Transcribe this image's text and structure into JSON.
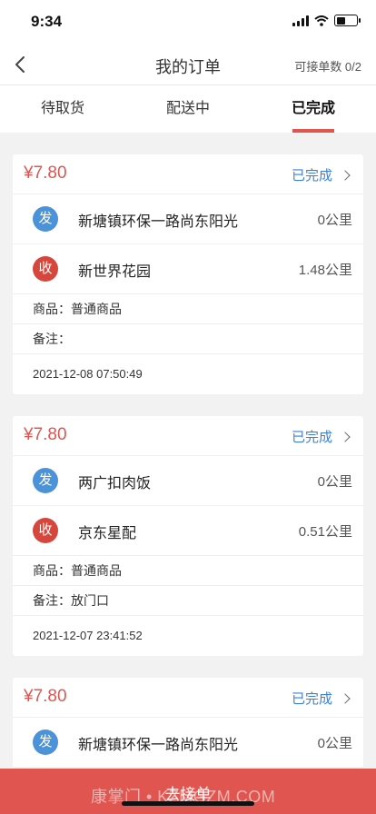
{
  "status_bar": {
    "time": "9:34"
  },
  "nav": {
    "title": "我的订单",
    "right_text": "可接单数 0/2"
  },
  "tabs": [
    {
      "label": "待取货",
      "active": false
    },
    {
      "label": "配送中",
      "active": false
    },
    {
      "label": "已完成",
      "active": true
    }
  ],
  "orders": [
    {
      "price": "¥7.80",
      "status": "已完成",
      "sender": {
        "badge": "发",
        "name": "新塘镇环保一路尚东阳光",
        "distance": "0公里"
      },
      "receiver": {
        "badge": "收",
        "name": "新世界花园",
        "distance": "1.48公里"
      },
      "goods": "商品：普通商品",
      "remark": "备注：",
      "time": "2021-12-08 07:50:49"
    },
    {
      "price": "¥7.80",
      "status": "已完成",
      "sender": {
        "badge": "发",
        "name": "两广扣肉饭",
        "distance": "0公里"
      },
      "receiver": {
        "badge": "收",
        "name": "京东星配",
        "distance": "0.51公里"
      },
      "goods": "商品：普通商品",
      "remark": "备注：放门口",
      "time": "2021-12-07 23:41:52"
    },
    {
      "price": "¥7.80",
      "status": "已完成",
      "sender": {
        "badge": "发",
        "name": "新塘镇环保一路尚东阳光",
        "distance": "0公里"
      }
    }
  ],
  "bottom": {
    "button_label": "去接单",
    "watermark": "康掌门 • KZMGZM.COM"
  },
  "colors": {
    "accent": "#e0554f",
    "link": "#3e7fd8",
    "send_badge": "#4b92d8",
    "recv_badge": "#d6463d"
  }
}
